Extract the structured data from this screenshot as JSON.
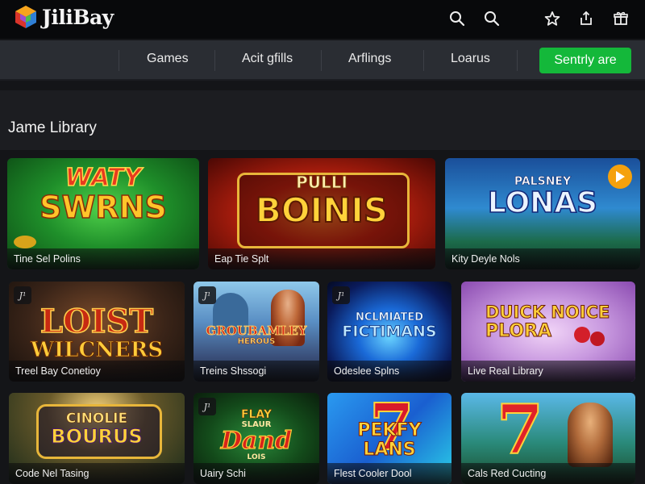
{
  "app": {
    "name": "JiliBay"
  },
  "topbar": {
    "icons": [
      "search-icon",
      "search-icon",
      "star-icon",
      "share-icon",
      "gift-icon"
    ]
  },
  "nav": {
    "items": [
      {
        "label": "Games"
      },
      {
        "label": "Acit gfills"
      },
      {
        "label": "Arflings"
      },
      {
        "label": "Loarus"
      }
    ],
    "cta_label": "Sentrly are"
  },
  "section": {
    "title": "Jame Library"
  },
  "colors": {
    "accent_green": "#14b83a",
    "play_orange": "#f5a10d"
  },
  "cards": [
    {
      "art_title": [
        "WATY",
        "SWRNS"
      ],
      "caption": "Tine Sel Polins"
    },
    {
      "art_title": [
        "PULLI",
        "BOINIS"
      ],
      "caption": "Eap Tie Splt"
    },
    {
      "art_title": [
        "PALSNEY",
        "LONAS"
      ],
      "caption": "Kity Deyle Nols",
      "play": true
    },
    {
      "art_title": [
        "LOIST",
        "WILCNERS"
      ],
      "caption": "Treel Bay Conetioy",
      "badge": "J¹"
    },
    {
      "art_title": [
        "GROUBAMLEY",
        "HEROUS"
      ],
      "caption": "Treins Shssogi",
      "badge": "J¹"
    },
    {
      "art_title": [
        "NCLMIATED",
        "FICTIMANS"
      ],
      "caption": "Odeslee Splns",
      "badge": "J¹"
    },
    {
      "art_title": [
        "DUICK NOICE",
        "PLORA"
      ],
      "caption": "Live Real Library"
    },
    {
      "art_title": [
        "CINOLIE",
        "BOURUS"
      ],
      "caption": "Code Nel Tasing"
    },
    {
      "art_title": [
        "FLAY",
        "SLAUR",
        "Dand",
        "LOIS"
      ],
      "caption": "Uairy Schi",
      "badge": "J¹"
    },
    {
      "art_title": [
        "PEKFY",
        "LANS"
      ],
      "caption": "Flest Cooler Dool"
    },
    {
      "art_title": [
        "7"
      ],
      "caption": "Cals Red Cucting"
    }
  ]
}
